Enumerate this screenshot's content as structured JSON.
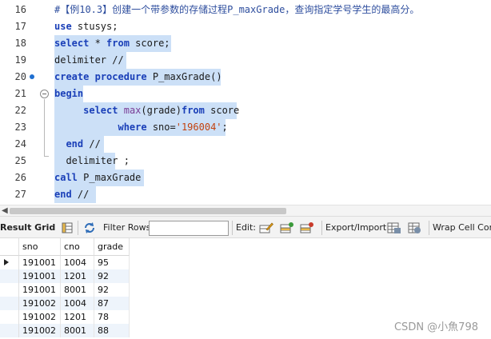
{
  "editor": {
    "lines": [
      {
        "num": "16",
        "tokens": [
          {
            "t": "#【例10.3】创建一个带参数的存储过程P_maxGrade，查询指定学号学生的最高分。",
            "c": "cmt"
          }
        ]
      },
      {
        "num": "17",
        "tokens": [
          {
            "t": "use",
            "c": "kw"
          },
          {
            "t": " stusys;",
            "c": ""
          }
        ]
      },
      {
        "num": "18",
        "tokens": [
          {
            "t": "select",
            "c": "kw"
          },
          {
            "t": " * ",
            "c": ""
          },
          {
            "t": "from",
            "c": "kw"
          },
          {
            "t": " score;",
            "c": ""
          }
        ]
      },
      {
        "num": "19",
        "tokens": [
          {
            "t": "delimiter //",
            "c": ""
          }
        ]
      },
      {
        "num": "20",
        "tokens": [
          {
            "t": "create",
            "c": "kw"
          },
          {
            "t": " ",
            "c": ""
          },
          {
            "t": "procedure",
            "c": "kw"
          },
          {
            "t": " P_maxGrade()",
            "c": ""
          }
        ]
      },
      {
        "num": "21",
        "tokens": [
          {
            "t": "begin",
            "c": "kw"
          }
        ]
      },
      {
        "num": "22",
        "tokens": [
          {
            "t": "     ",
            "c": ""
          },
          {
            "t": "select",
            "c": "kw"
          },
          {
            "t": " ",
            "c": ""
          },
          {
            "t": "max",
            "c": "fn"
          },
          {
            "t": "(grade)",
            "c": ""
          },
          {
            "t": "from",
            "c": "kw"
          },
          {
            "t": " score",
            "c": ""
          }
        ]
      },
      {
        "num": "23",
        "tokens": [
          {
            "t": "           ",
            "c": ""
          },
          {
            "t": "where",
            "c": "kw"
          },
          {
            "t": " sno=",
            "c": ""
          },
          {
            "t": "'196004'",
            "c": "str"
          },
          {
            "t": ";",
            "c": ""
          }
        ]
      },
      {
        "num": "24",
        "tokens": [
          {
            "t": "  ",
            "c": ""
          },
          {
            "t": "end",
            "c": "kw"
          },
          {
            "t": " //",
            "c": ""
          }
        ]
      },
      {
        "num": "25",
        "tokens": [
          {
            "t": "  delimiter ;",
            "c": ""
          }
        ]
      },
      {
        "num": "26",
        "tokens": [
          {
            "t": "call",
            "c": "kw"
          },
          {
            "t": " P_maxGrade",
            "c": ""
          }
        ]
      },
      {
        "num": "27",
        "tokens": [
          {
            "t": "end",
            "c": "kw"
          },
          {
            "t": " //",
            "c": ""
          }
        ]
      }
    ]
  },
  "toolbar": {
    "result_grid_label": "Result Grid",
    "filter_rows_label": "Filter Rows:",
    "filter_value": "",
    "edit_label": "Edit:",
    "export_label": "Export/Import:",
    "wrap_label": "Wrap Cell Conte"
  },
  "grid": {
    "columns": [
      "sno",
      "cno",
      "grade"
    ],
    "rows": [
      [
        "191001",
        "1004",
        "95"
      ],
      [
        "191001",
        "1201",
        "92"
      ],
      [
        "191001",
        "8001",
        "92"
      ],
      [
        "191002",
        "1004",
        "87"
      ],
      [
        "191002",
        "1201",
        "78"
      ],
      [
        "191002",
        "8001",
        "88"
      ]
    ]
  },
  "watermark": "CSDN @小魚798",
  "colors": {
    "keyword": "#1a3fb8",
    "selection": "#cce0f7",
    "breakpoint": "#1f6fd1"
  }
}
